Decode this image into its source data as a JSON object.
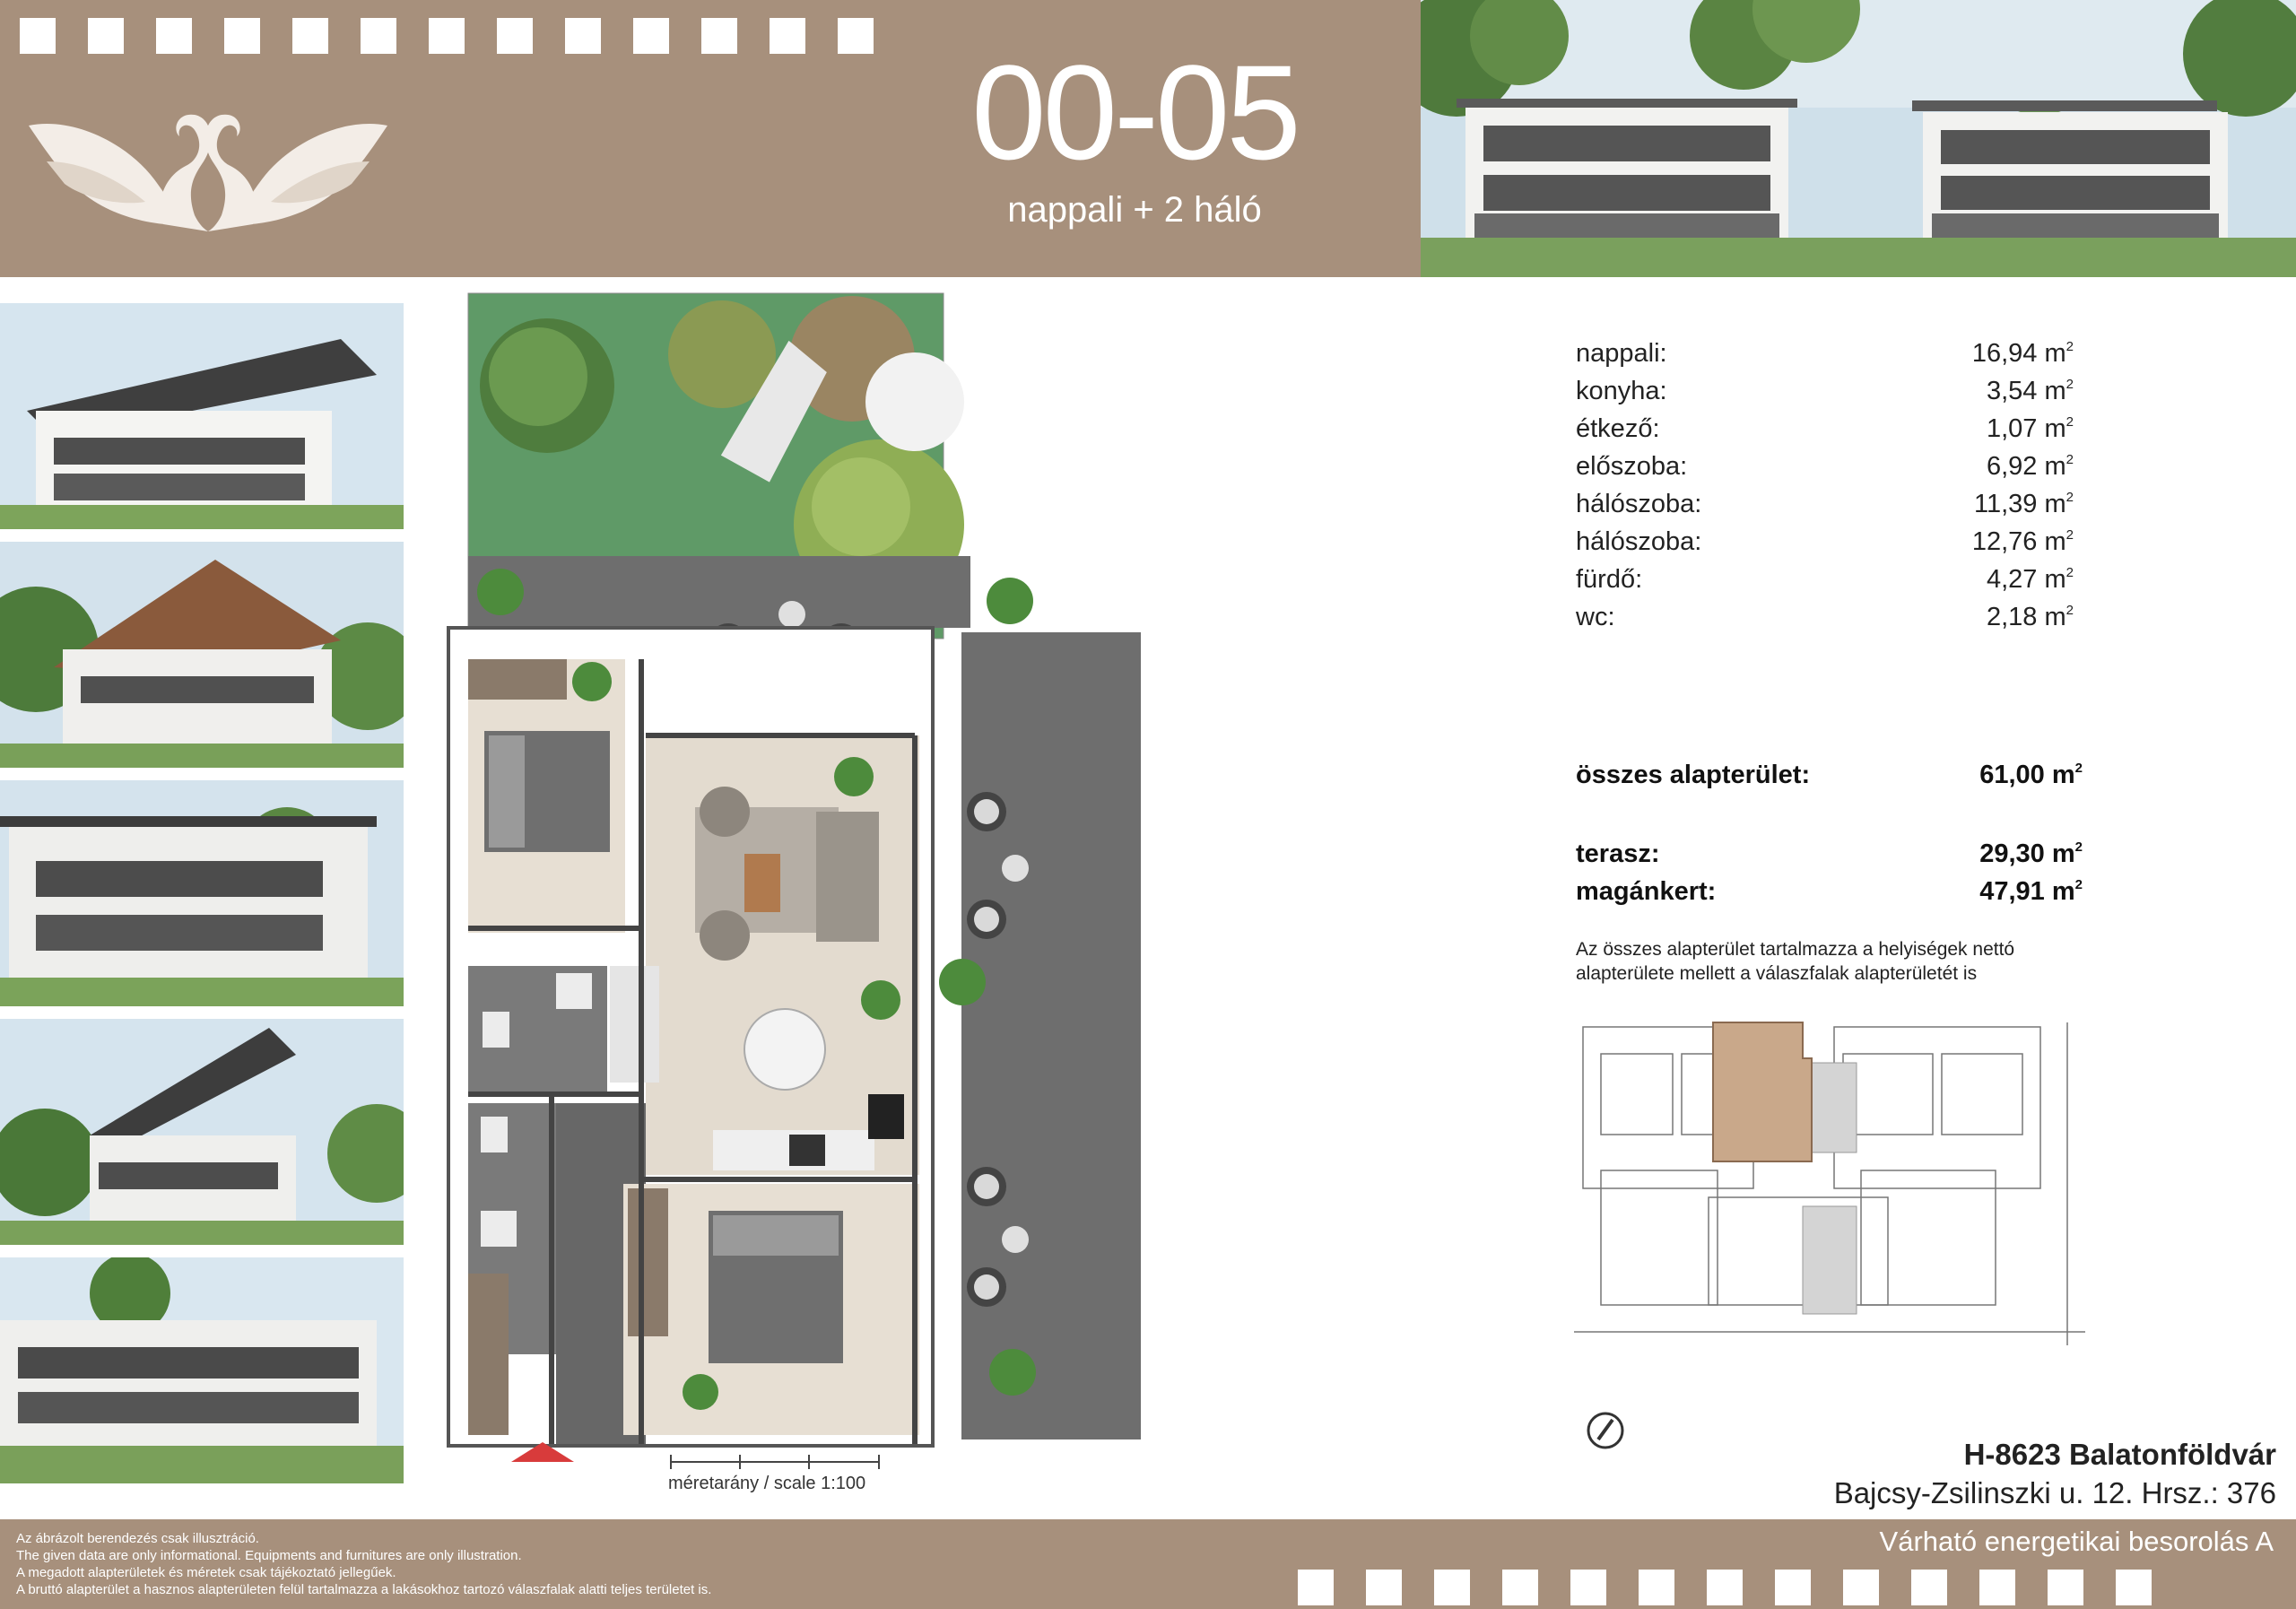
{
  "header": {
    "apartment_code": "00-05",
    "apartment_type": "nappali + 2 háló"
  },
  "areas": [
    {
      "label": "nappali:",
      "value": "16,94 m",
      "unit_sup": "2"
    },
    {
      "label": "konyha:",
      "value": "3,54 m",
      "unit_sup": "2"
    },
    {
      "label": "étkező:",
      "value": "1,07 m",
      "unit_sup": "2"
    },
    {
      "label": "előszoba:",
      "value": "6,92 m",
      "unit_sup": "2"
    },
    {
      "label": "hálószoba:",
      "value": "11,39 m",
      "unit_sup": "2"
    },
    {
      "label": "hálószoba:",
      "value": "12,76 m",
      "unit_sup": "2"
    },
    {
      "label": "fürdő:",
      "value": "4,27 m",
      "unit_sup": "2"
    },
    {
      "label": "wc:",
      "value": "2,18 m",
      "unit_sup": "2"
    }
  ],
  "totals": {
    "total_label": "összes alapterület:",
    "total_value": "61,00 m",
    "terrace_label": "terasz:",
    "terrace_value": "29,30 m",
    "garden_label": "magánkert:",
    "garden_value": "47,91 m",
    "unit_sup": "2"
  },
  "note": "Az összes alapterület tartalmazza a helyiségek nettó alapterülete mellett a válaszfalak alapterületét is",
  "scale_label": "méretarány / scale 1:100",
  "address": {
    "line1": "H-8623 Balatonföldvár",
    "line2": "Bajcsy-Zsilinszki u. 12. Hrsz.: 376"
  },
  "footer": {
    "disclaimer": [
      "Az ábrázolt berendezés csak illusztráció.",
      "The given data are only informational. Equipments and furnitures are only illustration.",
      "A megadott alapterületek és méretek csak tájékoztató jellegűek.",
      "A bruttó alapterület a hasznos alapterületen felül tartalmazza a lakásokhoz tartozó válaszfalak alatti teljes területet is."
    ],
    "energy_rating": "Várható energetikai besorolás A"
  },
  "colors": {
    "band": "#a7907c",
    "highlight_unit": "#c9a88a",
    "garden": "#5f9a67",
    "terrace": "#6e6e6e"
  },
  "icons": [
    "swan-logo-icon",
    "compass-icon",
    "north-arrow-icon"
  ]
}
